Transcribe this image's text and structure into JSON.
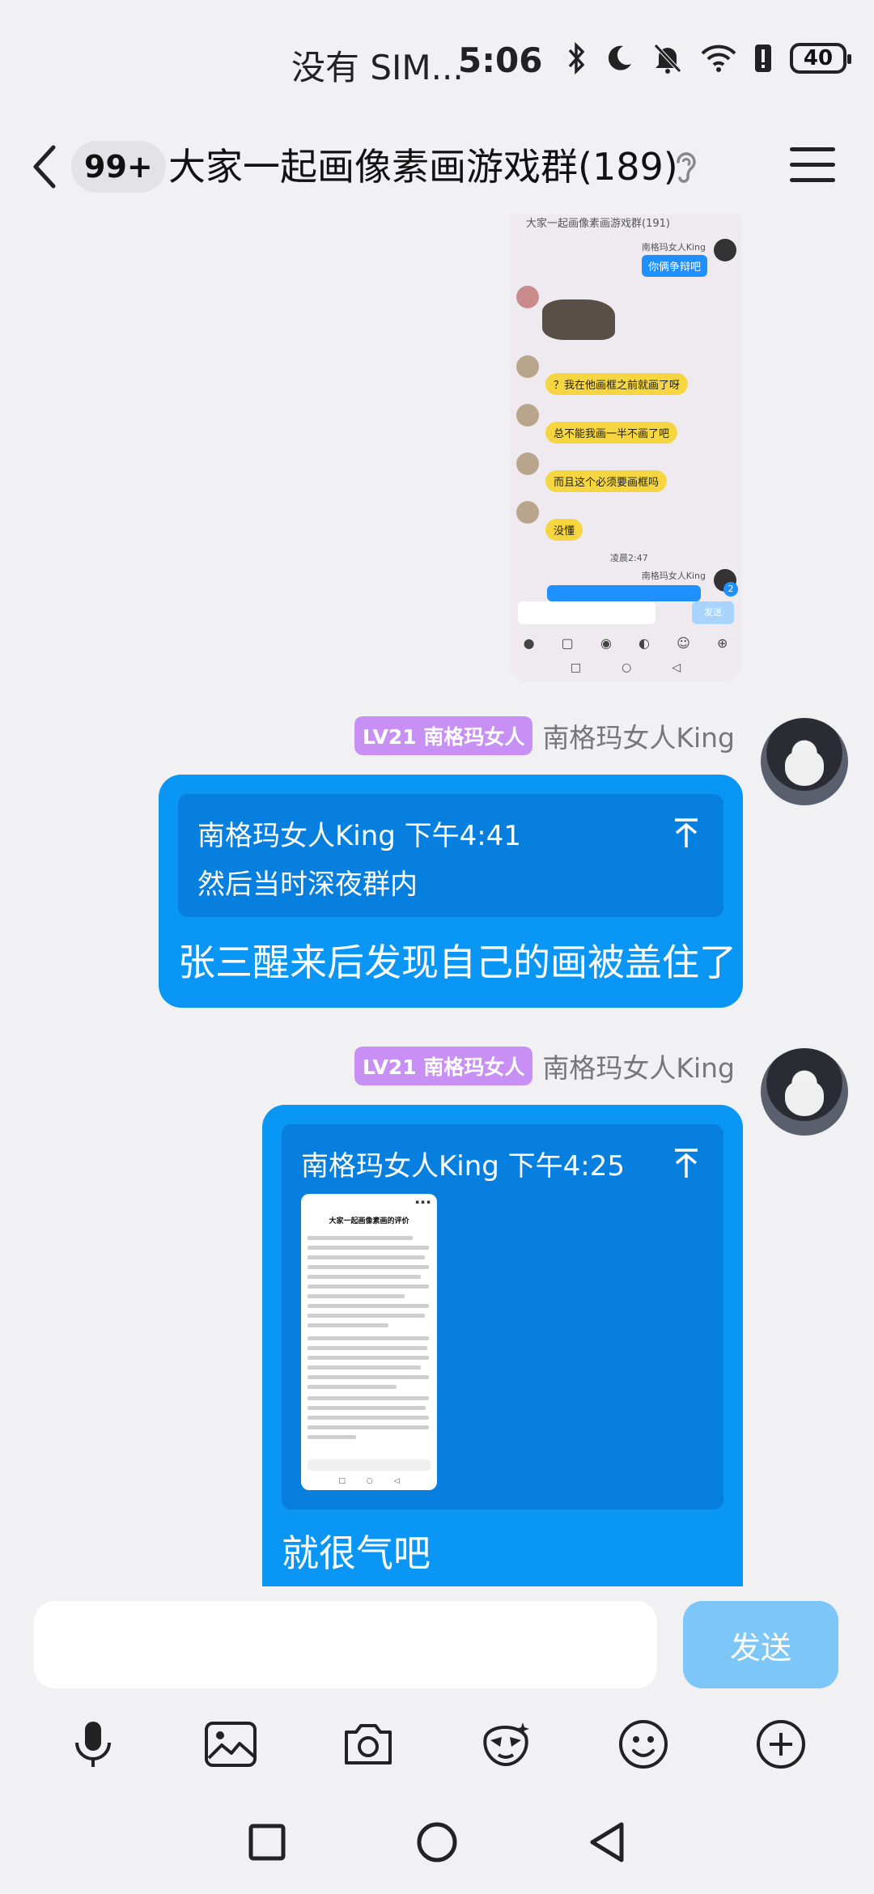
{
  "status_bar": {
    "carrier": "没有 SIM...",
    "time": "5:06",
    "battery": "40",
    "icons": [
      "bluetooth-icon",
      "moon-icon",
      "bell-off-icon",
      "wifi-icon",
      "battery-alert-icon",
      "battery-icon"
    ]
  },
  "header": {
    "unread_badge": "99+",
    "title": "大家一起画像素画游戏群(189)",
    "icons": [
      "back-icon",
      "ear-icon",
      "menu-icon"
    ]
  },
  "image_message": {
    "title_fragment": "大家一起画像素画游戏群(191)",
    "rows": [
      {
        "sender": "南格玛女人King",
        "text": "你俩争辩吧",
        "side": "right"
      },
      {
        "text": "？我在他画框之前就画了呀",
        "side": "left"
      },
      {
        "text": "总不能我画一半不画了吧",
        "side": "left"
      },
      {
        "text": "而且这个必须要画框吗",
        "side": "left"
      },
      {
        "text": "没懂",
        "side": "left"
      }
    ],
    "time_label": "凌晨2:47",
    "send_label": "发送",
    "notification_count": "2"
  },
  "messages": [
    {
      "level": "LV21 南格玛女人",
      "sender": "南格玛女人King",
      "quote_header": "南格玛女人King 下午4:41",
      "quote_text": "然后当时深夜群内",
      "text": "张三醒来后发现自己的画被盖住了"
    },
    {
      "level": "LV21 南格玛女人",
      "sender": "南格玛女人King",
      "quote_header": "南格玛女人King 下午4:25",
      "quote_thumb_title": "大家一起画像素画的评价",
      "text": "就很气吧"
    }
  ],
  "input": {
    "placeholder": "",
    "value": "",
    "send_label": "发送"
  },
  "toolbar": [
    "microphone-icon",
    "image-icon",
    "camera-icon",
    "sticker-icon",
    "emoji-icon",
    "plus-icon"
  ],
  "nav": [
    "recent-apps-icon",
    "home-icon",
    "back-nav-icon"
  ],
  "colors": {
    "bubble_blue": "#0a96f5",
    "quote_blue": "#077fde",
    "level_badge": "#c88ff5",
    "send_button": "#7cc6f8",
    "background": "#f1f1f4"
  }
}
